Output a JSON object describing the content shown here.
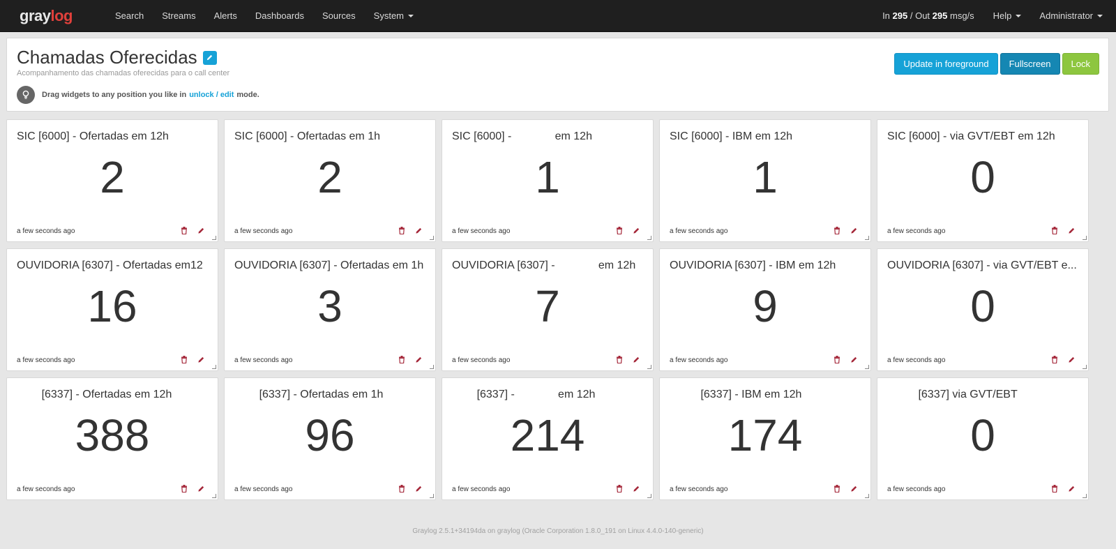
{
  "nav": {
    "brand_part1": "gray",
    "brand_part2": "log",
    "links": [
      "Search",
      "Streams",
      "Alerts",
      "Dashboards",
      "Sources"
    ],
    "system_label": "System",
    "throughput_in_label": "In",
    "throughput_in": "295",
    "throughput_sep": "/ Out",
    "throughput_out": "295",
    "throughput_unit": "msg/s",
    "help_label": "Help",
    "user_label": "Administrator"
  },
  "dashboard": {
    "title": "Chamadas Oferecidas",
    "description": "Acompanhamento das chamadas oferecidas para o call center",
    "hint_prefix": "Drag widgets to any position you like in",
    "hint_link": "unlock / edit",
    "hint_suffix": "mode.",
    "buttons": {
      "update": "Update in foreground",
      "fullscreen": "Fullscreen",
      "lock": "Lock"
    }
  },
  "widgets": [
    {
      "title": "SIC [6000] - Ofertadas em 12h",
      "value": "2",
      "time": "a few seconds ago"
    },
    {
      "title": "SIC [6000] - Ofertadas em 1h",
      "value": "2",
      "time": "a few seconds ago"
    },
    {
      "title": "SIC [6000] -              em 12h",
      "value": "1",
      "time": "a few seconds ago"
    },
    {
      "title": "SIC [6000] - IBM em 12h",
      "value": "1",
      "time": "a few seconds ago"
    },
    {
      "title": "SIC [6000] - via GVT/EBT em 12h",
      "value": "0",
      "time": "a few seconds ago"
    },
    {
      "title": "OUVIDORIA [6307] - Ofertadas em12",
      "value": "16",
      "time": "a few seconds ago"
    },
    {
      "title": "OUVIDORIA [6307] - Ofertadas em 1h",
      "value": "3",
      "time": "a few seconds ago"
    },
    {
      "title": "OUVIDORIA [6307] -              em 12h",
      "value": "7",
      "time": "a few seconds ago"
    },
    {
      "title": "OUVIDORIA [6307] - IBM em 12h",
      "value": "9",
      "time": "a few seconds ago"
    },
    {
      "title": "OUVIDORIA [6307] - via GVT/EBT e...",
      "value": "0",
      "time": "a few seconds ago"
    },
    {
      "title": "        [6337] - Ofertadas em 12h",
      "value": "388",
      "time": "a few seconds ago"
    },
    {
      "title": "        [6337] - Ofertadas em 1h",
      "value": "96",
      "time": "a few seconds ago"
    },
    {
      "title": "        [6337] -              em 12h",
      "value": "214",
      "time": "a few seconds ago"
    },
    {
      "title": "          [6337] - IBM em 12h",
      "value": "174",
      "time": "a few seconds ago"
    },
    {
      "title": "          [6337] via GVT/EBT",
      "value": "0",
      "time": "a few seconds ago"
    }
  ],
  "footer": "Graylog 2.5.1+34194da on graylog (Oracle Corporation 1.8.0_191 on Linux 4.4.0-140-generic)",
  "colors": {
    "navbar": "#1f1f1f",
    "accent": "#16a2d7",
    "primary": "#1587b3",
    "success": "#8dc63f",
    "danger": "#a5283a"
  }
}
